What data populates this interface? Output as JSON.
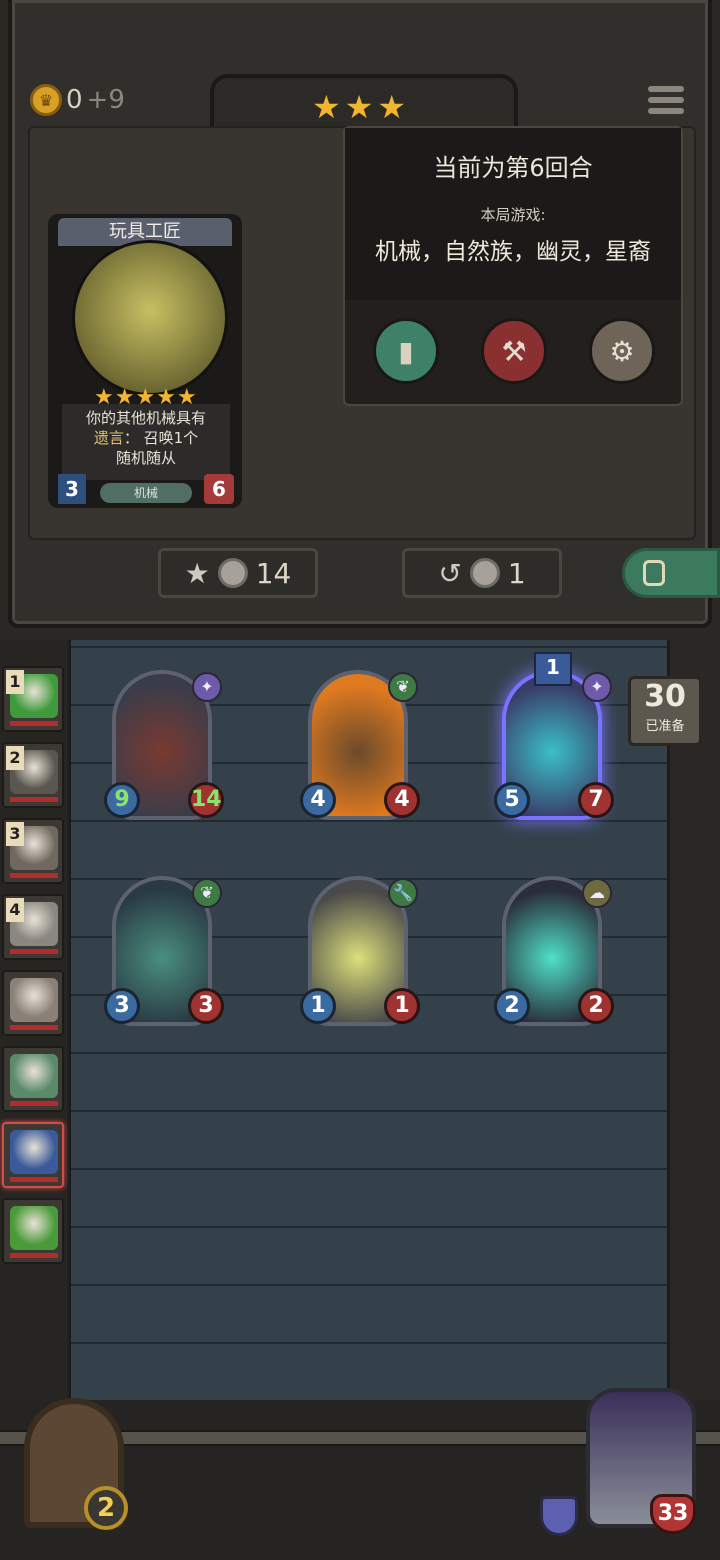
{
  "header": {
    "gold": "0",
    "gold_income": "+9",
    "stars": "★★★",
    "progress_fraction": 0.23
  },
  "card": {
    "name": "玩具工匠",
    "stars": "★★★★★",
    "text_line1": "你的其他机械具有",
    "keyword": "遗言",
    "text_line2_rest": "： 召唤1个",
    "text_line3": "随机随从",
    "tag": "机械",
    "attack": "3",
    "health": "6"
  },
  "popup": {
    "title": "当前为第6回合",
    "subtitle": "本局游戏:",
    "races": "机械，自然族，幽灵，星裔",
    "buttons": [
      {
        "icon": "book-icon"
      },
      {
        "icon": "hammer-icon"
      },
      {
        "icon": "gear-icon"
      }
    ]
  },
  "actions": {
    "upgrade_cost": "14",
    "refresh_cost": "1"
  },
  "ready": {
    "count": "30",
    "label": "已准备"
  },
  "board": {
    "minions": [
      {
        "attack": "9",
        "health": "14",
        "race_icon": "✦",
        "race_color": "#6d5aa8",
        "art": [
          "#7a3a30",
          "#3a3c4a"
        ],
        "buff": true
      },
      {
        "attack": "4",
        "health": "4",
        "race_icon": "❦",
        "race_color": "#3f7a44",
        "art": [
          "#6b4a2a",
          "#e07a20"
        ],
        "buff": false
      },
      {
        "attack": "5",
        "health": "7",
        "race_icon": "✦",
        "race_color": "#6d5aa8",
        "art": [
          "#3ac0c8",
          "#3a3c68"
        ],
        "buff": false,
        "tier": "1"
      },
      {
        "attack": "3",
        "health": "3",
        "race_icon": "❦",
        "race_color": "#3f7a44",
        "art": [
          "#4a8f7e",
          "#2a3a44"
        ],
        "buff": false
      },
      {
        "attack": "1",
        "health": "1",
        "race_icon": "🔧",
        "race_color": "#3f7a44",
        "art": [
          "#dde07a",
          "#4a4a4a"
        ],
        "buff": false
      },
      {
        "attack": "2",
        "health": "2",
        "race_icon": "☁",
        "race_color": "#6e6a40",
        "art": [
          "#4ee0c8",
          "#2a2e3a"
        ],
        "buff": false
      }
    ]
  },
  "opponents": [
    {
      "rank": "1",
      "color": "#3e9a3a"
    },
    {
      "rank": "2",
      "color": "#5a5650"
    },
    {
      "rank": "3",
      "color": "#706860"
    },
    {
      "rank": "4",
      "color": "#8a8680"
    },
    {
      "rank": "",
      "color": "#8a8078"
    },
    {
      "rank": "",
      "color": "#5a8a6a"
    },
    {
      "rank": "",
      "color": "#3a5a9a",
      "active": true
    },
    {
      "rank": "",
      "color": "#4a9a3a"
    }
  ],
  "tavern": {
    "level": "2"
  },
  "hero": {
    "health": "33"
  }
}
